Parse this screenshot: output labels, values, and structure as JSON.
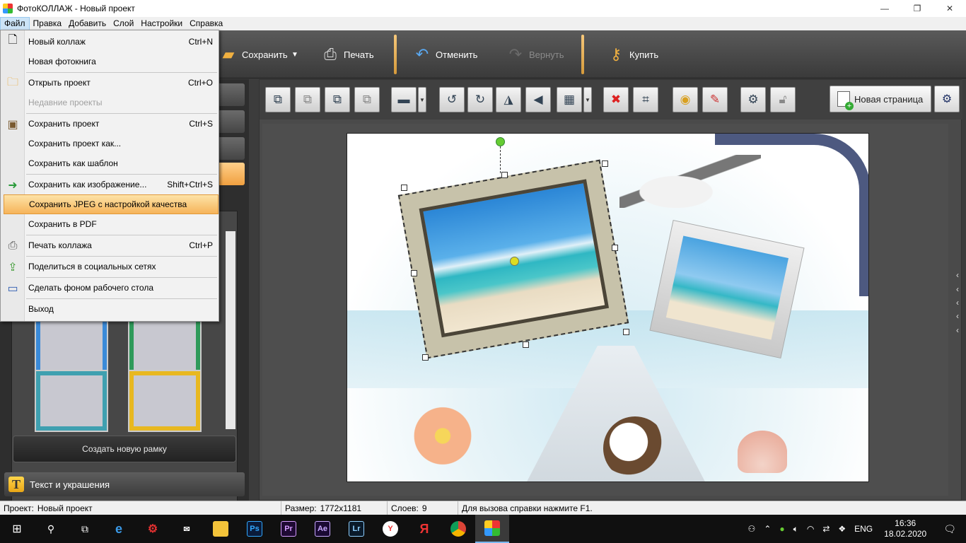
{
  "window": {
    "title": "ФотоКОЛЛАЖ - Новый проект",
    "minimize": "—",
    "maximize": "❐",
    "close": "✕"
  },
  "menubar": [
    "Файл",
    "Правка",
    "Добавить",
    "Слой",
    "Настройки",
    "Справка"
  ],
  "toolbar": {
    "save": "Сохранить",
    "print": "Печать",
    "undo": "Отменить",
    "redo": "Вернуть",
    "buy": "Купить"
  },
  "file_menu": [
    {
      "label": "Новый коллаж",
      "shortcut": "Ctrl+N",
      "icon": "page-icon"
    },
    {
      "label": "Новая фотокнига",
      "shortcut": ""
    },
    {
      "label": "Открыть проект",
      "shortcut": "Ctrl+O",
      "icon": "folder-icon"
    },
    {
      "label": "Недавние проекты",
      "shortcut": "",
      "disabled": true
    },
    {
      "label": "Сохранить проект",
      "shortcut": "Ctrl+S",
      "icon": "floppy-icon"
    },
    {
      "label": "Сохранить проект как...",
      "shortcut": ""
    },
    {
      "label": "Сохранить как шаблон",
      "shortcut": ""
    },
    {
      "label": "Сохранить как изображение...",
      "shortcut": "Shift+Ctrl+S",
      "icon": "export-icon"
    },
    {
      "label": "Сохранить JPEG с настройкой качества",
      "shortcut": "",
      "highlighted": true
    },
    {
      "label": "Сохранить в PDF",
      "shortcut": ""
    },
    {
      "label": "Печать коллажа",
      "shortcut": "Ctrl+P",
      "icon": "printer-icon"
    },
    {
      "label": "Поделиться в социальных сетях",
      "shortcut": "",
      "icon": "share-icon"
    },
    {
      "label": "Сделать фоном рабочего стола",
      "shortcut": "",
      "icon": "monitor-icon"
    },
    {
      "label": "Выход",
      "shortcut": ""
    }
  ],
  "left_panel": {
    "create_frame": "Создать новую рамку",
    "text_tab": "Текст и украшения",
    "text_tab_icon": "T"
  },
  "tool_strip": {
    "new_page": "Новая страница"
  },
  "statusbar": {
    "project_label": "Проект:",
    "project_value": "Новый проект",
    "size_label": "Размер:",
    "size_value": "1772x1181",
    "layers_label": "Слоев:",
    "layers_value": "9",
    "help": "Для вызова справки нажмите F1."
  },
  "taskbar": {
    "apps": [
      "Ps",
      "Pr",
      "Ae",
      "Lr"
    ],
    "lang": "ENG",
    "time": "16:36",
    "date": "18.02.2020"
  }
}
